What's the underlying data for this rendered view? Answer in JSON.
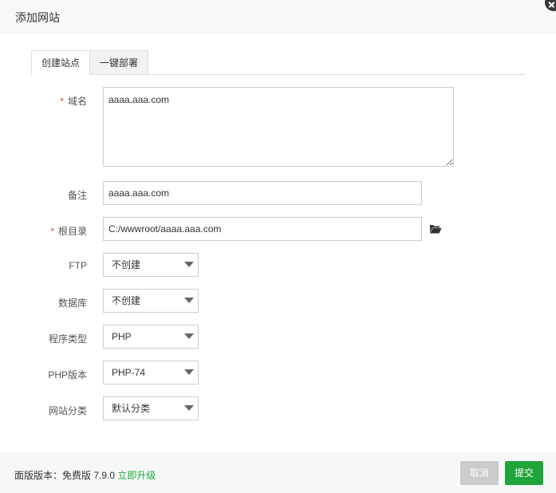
{
  "dialog": {
    "title": "添加网站"
  },
  "tabs": [
    {
      "label": "创建站点",
      "active": true
    },
    {
      "label": "一键部署",
      "active": false
    }
  ],
  "form": {
    "domain": {
      "label": "域名",
      "required": true,
      "value": "aaaa.aaa.com"
    },
    "remark": {
      "label": "备注",
      "value": "aaaa.aaa.com"
    },
    "root": {
      "label": "根目录",
      "required": true,
      "value": "C:/wwwroot/aaaa.aaa.com",
      "icon": "folder-open-icon"
    },
    "ftp": {
      "label": "FTP",
      "selected": "不创建"
    },
    "database": {
      "label": "数据库",
      "selected": "不创建"
    },
    "program_type": {
      "label": "程序类型",
      "selected": "PHP"
    },
    "php_version": {
      "label": "PHP版本",
      "selected": "PHP-74"
    },
    "site_category": {
      "label": "网站分类",
      "selected": "默认分类"
    }
  },
  "footer": {
    "version_text": "面版版本：免费版 7.9.0",
    "upgrade_link": "立即升级",
    "cancel_label": "取消",
    "submit_label": "提交"
  },
  "colors": {
    "accent": "#20a53a",
    "required": "#e74c3c",
    "cancel": "#cbcbcb"
  }
}
